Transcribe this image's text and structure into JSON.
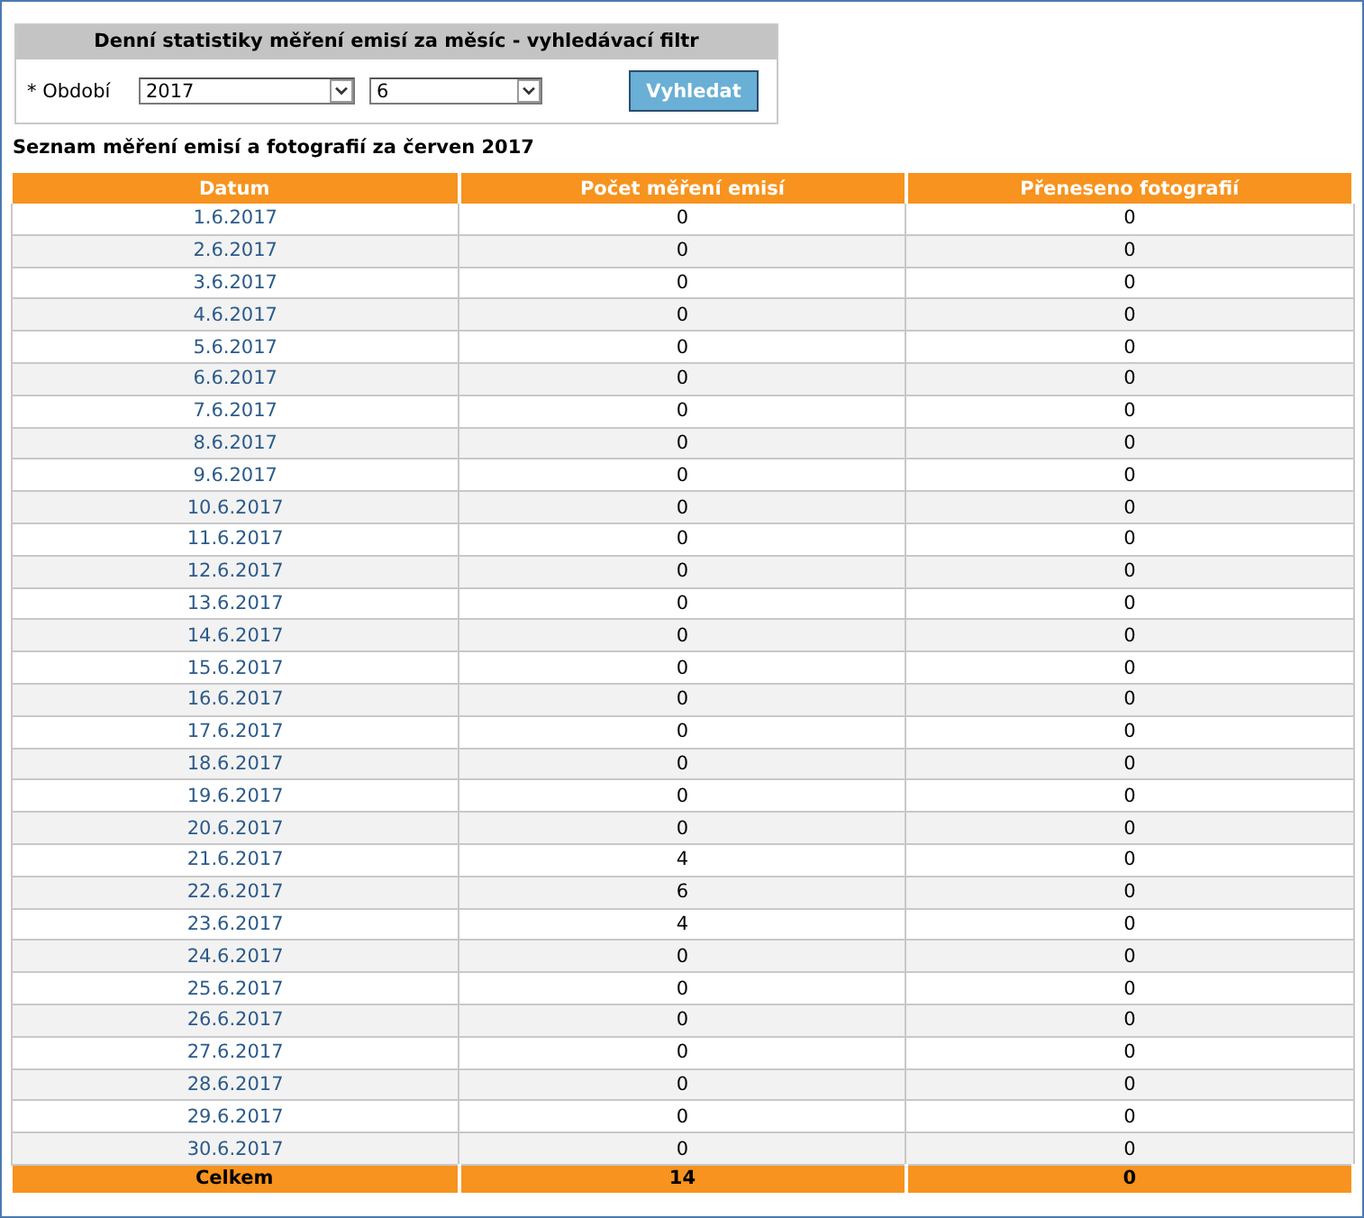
{
  "filter": {
    "title": "Denní statistiky měření emisí za měsíc - vyhledávací filtr",
    "label": "* Období",
    "year": "2017",
    "month": "6",
    "button": "Vyhledat"
  },
  "heading": "Seznam měření emisí a fotografií za červen 2017",
  "table": {
    "columns": [
      "Datum",
      "Počet měření emisí",
      "Přeneseno fotografií"
    ],
    "rows": [
      [
        "1.6.2017",
        "0",
        "0"
      ],
      [
        "2.6.2017",
        "0",
        "0"
      ],
      [
        "3.6.2017",
        "0",
        "0"
      ],
      [
        "4.6.2017",
        "0",
        "0"
      ],
      [
        "5.6.2017",
        "0",
        "0"
      ],
      [
        "6.6.2017",
        "0",
        "0"
      ],
      [
        "7.6.2017",
        "0",
        "0"
      ],
      [
        "8.6.2017",
        "0",
        "0"
      ],
      [
        "9.6.2017",
        "0",
        "0"
      ],
      [
        "10.6.2017",
        "0",
        "0"
      ],
      [
        "11.6.2017",
        "0",
        "0"
      ],
      [
        "12.6.2017",
        "0",
        "0"
      ],
      [
        "13.6.2017",
        "0",
        "0"
      ],
      [
        "14.6.2017",
        "0",
        "0"
      ],
      [
        "15.6.2017",
        "0",
        "0"
      ],
      [
        "16.6.2017",
        "0",
        "0"
      ],
      [
        "17.6.2017",
        "0",
        "0"
      ],
      [
        "18.6.2017",
        "0",
        "0"
      ],
      [
        "19.6.2017",
        "0",
        "0"
      ],
      [
        "20.6.2017",
        "0",
        "0"
      ],
      [
        "21.6.2017",
        "4",
        "0"
      ],
      [
        "22.6.2017",
        "6",
        "0"
      ],
      [
        "23.6.2017",
        "4",
        "0"
      ],
      [
        "24.6.2017",
        "0",
        "0"
      ],
      [
        "25.6.2017",
        "0",
        "0"
      ],
      [
        "26.6.2017",
        "0",
        "0"
      ],
      [
        "27.6.2017",
        "0",
        "0"
      ],
      [
        "28.6.2017",
        "0",
        "0"
      ],
      [
        "29.6.2017",
        "0",
        "0"
      ],
      [
        "30.6.2017",
        "0",
        "0"
      ]
    ],
    "total": [
      "Celkem",
      "14",
      "0"
    ]
  }
}
